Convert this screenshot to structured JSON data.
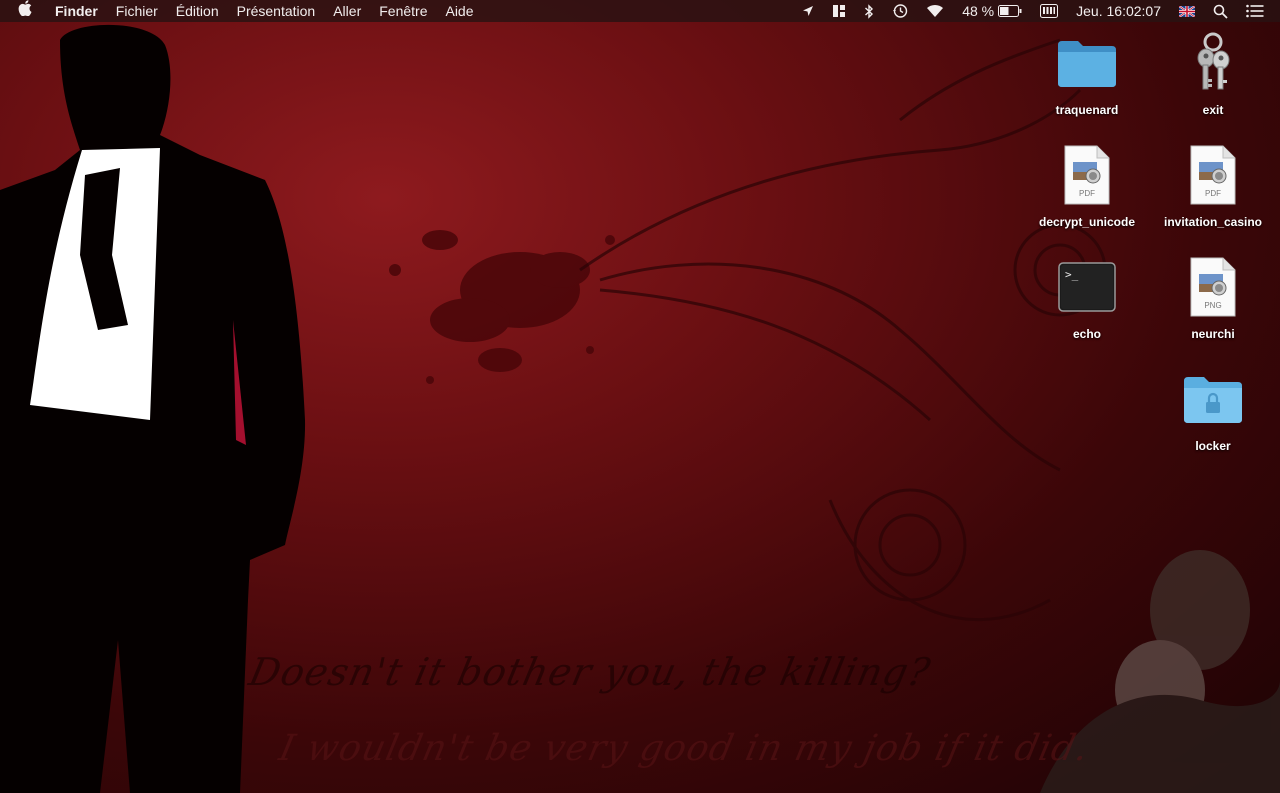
{
  "menubar": {
    "apple_icon": "apple-logo-icon",
    "app_name": "Finder",
    "items": [
      "Fichier",
      "Édition",
      "Présentation",
      "Aller",
      "Fenêtre",
      "Aide"
    ],
    "status": {
      "battery_percent": "48 %",
      "clock": "Jeu. 16:02:07",
      "icons": [
        "location-icon",
        "spaces-icon",
        "bluetooth-icon",
        "time-machine-icon",
        "wifi-icon",
        "battery-icon",
        "keyboard-icon",
        "uk-flag-icon",
        "spotlight-icon",
        "notification-center-icon"
      ]
    }
  },
  "desktop": {
    "icons": [
      {
        "label": "traquenard",
        "type": "folder"
      },
      {
        "label": "exit",
        "type": "keychain"
      },
      {
        "label": "decrypt_unicode",
        "type": "pdf",
        "badge": "PDF"
      },
      {
        "label": "invitation_casino",
        "type": "pdf",
        "badge": "PDF"
      },
      {
        "label": "echo",
        "type": "terminal",
        "prompt": ">_"
      },
      {
        "label": "neurchi",
        "type": "png",
        "badge": "PNG"
      },
      {
        "label": "locker",
        "type": "locked-folder"
      }
    ]
  },
  "wallpaper": {
    "quote_line1": "Doesn't it bother you, the killing?",
    "quote_line2": "I wouldn't be very good in my job if it did."
  },
  "colors": {
    "menubar_bg": "#281212",
    "wallpaper_primary": "#8e1a1e",
    "wallpaper_dark": "#1c0304",
    "folder_blue": "#4a9fd4"
  }
}
